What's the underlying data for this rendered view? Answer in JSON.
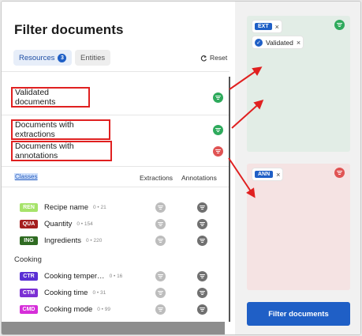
{
  "title": "Filter documents",
  "tabs": [
    {
      "label": "Resources",
      "badge": "3"
    },
    {
      "label": "Entities"
    }
  ],
  "reset_label": "Reset",
  "filters": [
    {
      "label": "Validated documents",
      "status_color": "#2eaa5c"
    },
    {
      "label": "Documents with extractions",
      "status_color": "#2eaa5c"
    },
    {
      "label": "Documents with annotations",
      "status_color": "#e05353"
    }
  ],
  "table": {
    "classes_label": "Classes",
    "col_extractions": "Extractions",
    "col_annotations": "Annotations"
  },
  "classes": [
    {
      "abbr": "REN",
      "color": "#a6e36a",
      "label": "Recipe name",
      "meta": "0 • 21"
    },
    {
      "abbr": "QUA",
      "color": "#a51d1d",
      "label": "Quantity",
      "meta": "0 • 154"
    },
    {
      "abbr": "ING",
      "color": "#2f6b22",
      "label": "Ingredients",
      "meta": "0 • 220"
    }
  ],
  "group_label": "Cooking",
  "cooking": [
    {
      "abbr": "CTR",
      "color": "#5a2fd4",
      "label": "Cooking temper…",
      "meta": "0 • 16"
    },
    {
      "abbr": "CTM",
      "color": "#7b2fd4",
      "label": "Cooking time",
      "meta": "0 • 31"
    },
    {
      "abbr": "CMD",
      "color": "#d62fd9",
      "label": "Cooking mode",
      "meta": "0 • 99"
    }
  ],
  "include_card": {
    "chips": [
      {
        "tag": "EXT",
        "close": "×"
      },
      {
        "label": "Validated",
        "close": "×",
        "icon": "check-icon"
      }
    ],
    "status_color": "#2eaa5c"
  },
  "exclude_card": {
    "chips": [
      {
        "tag": "ANN",
        "close": "×"
      }
    ],
    "status_color": "#e05353"
  },
  "filter_button": "Filter documents",
  "colors": {
    "accent": "#1f5fc6",
    "highlight": "#e02020"
  }
}
